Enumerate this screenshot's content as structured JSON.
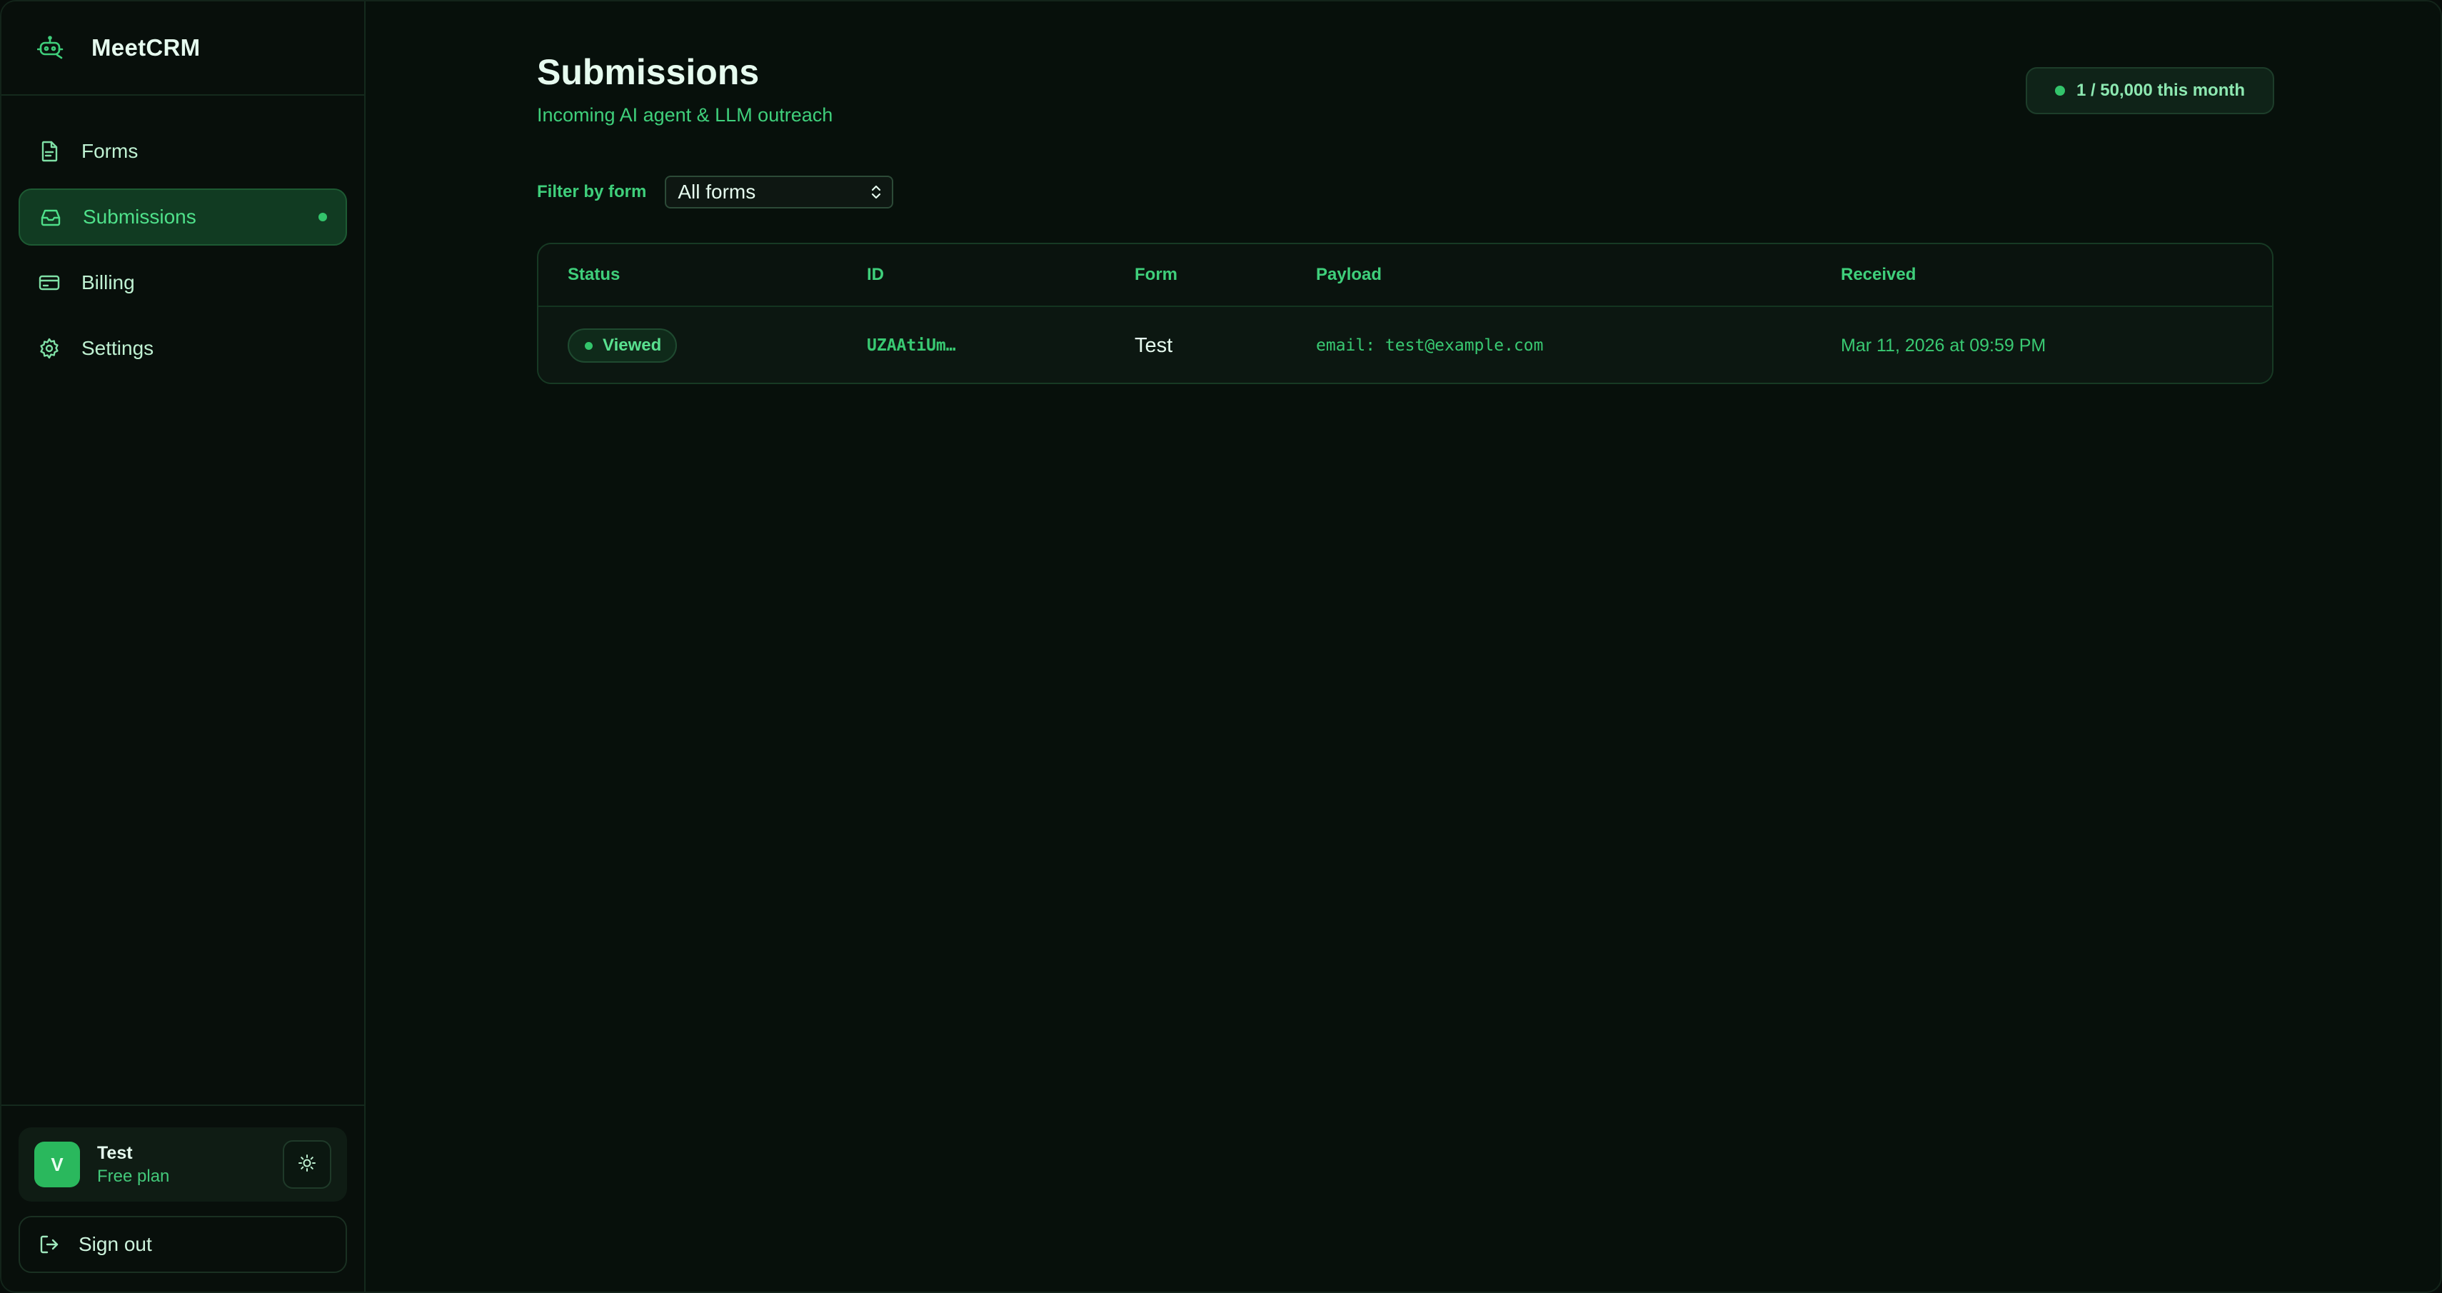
{
  "app": {
    "name": "MeetCRM"
  },
  "sidebar": {
    "items": [
      {
        "label": "Forms",
        "icon": "document-icon",
        "active": false
      },
      {
        "label": "Submissions",
        "icon": "inbox-icon",
        "active": true
      },
      {
        "label": "Billing",
        "icon": "credit-card-icon",
        "active": false
      },
      {
        "label": "Settings",
        "icon": "gear-icon",
        "active": false
      }
    ],
    "user": {
      "avatar_initial": "V",
      "name": "Test",
      "plan": "Free plan"
    },
    "sign_out_label": "Sign out"
  },
  "main": {
    "title": "Submissions",
    "subtitle": "Incoming AI agent & LLM outreach",
    "usage": "1 / 50,000 this month",
    "filter": {
      "label": "Filter by form",
      "selected": "All forms"
    },
    "table": {
      "columns": [
        "Status",
        "ID",
        "Form",
        "Payload",
        "Received"
      ],
      "rows": [
        {
          "status": "Viewed",
          "id": "UZAAtiUm…",
          "form": "Test",
          "payload": "email: test@example.com",
          "received": "Mar 11, 2026 at 09:59 PM"
        }
      ]
    }
  },
  "colors": {
    "accent": "#33c46b",
    "background": "#07100b",
    "text": "#e6fbef"
  }
}
